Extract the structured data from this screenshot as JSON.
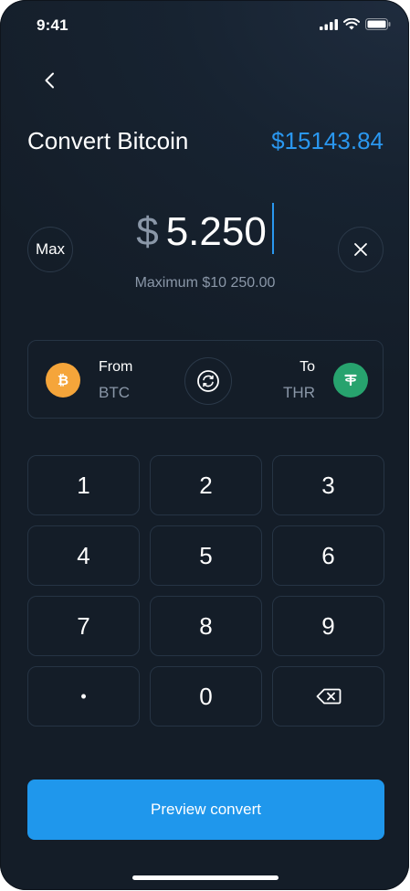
{
  "status_bar": {
    "time": "9:41"
  },
  "header": {
    "title": "Convert Bitcoin",
    "balance": "$15143.84"
  },
  "amount": {
    "currency_symbol": "$",
    "value": "5.250",
    "max_label": "Max",
    "maximum_text": "Maximum $10 250.00"
  },
  "conversion": {
    "from": {
      "label": "From",
      "currency": "BTC"
    },
    "to": {
      "label": "To",
      "currency": "THR"
    }
  },
  "keypad": {
    "keys": [
      "1",
      "2",
      "3",
      "4",
      "5",
      "6",
      "7",
      "8",
      "9",
      "•",
      "0"
    ]
  },
  "actions": {
    "preview_label": "Preview convert"
  },
  "colors": {
    "accent": "#1f97ec",
    "btc": "#f5a53a",
    "thr": "#27a36e",
    "background": "#172331"
  }
}
